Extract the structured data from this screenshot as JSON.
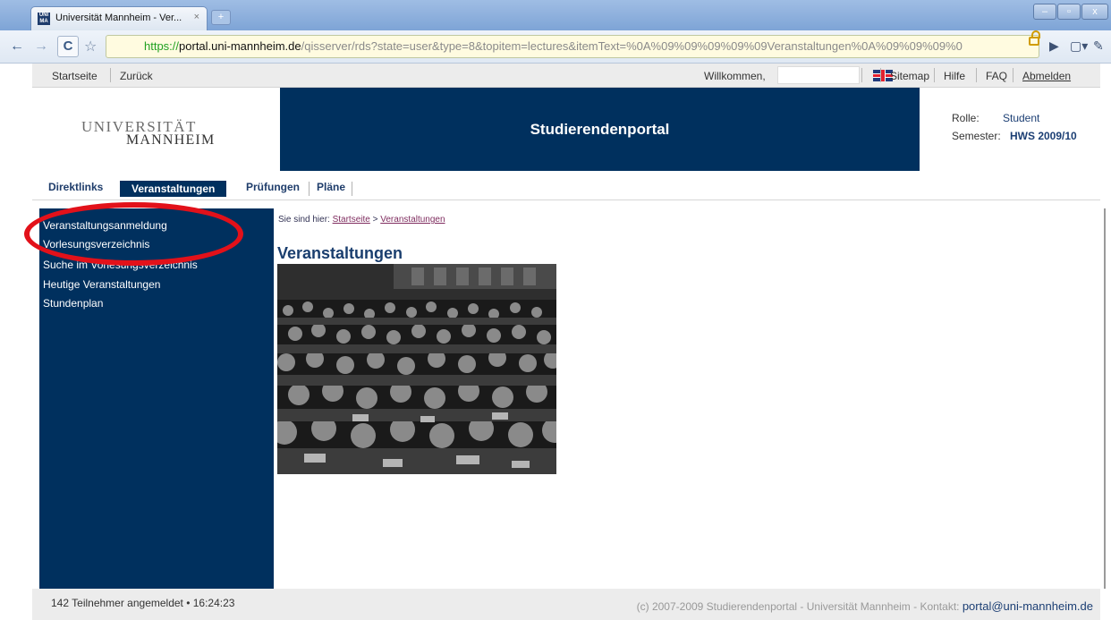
{
  "browser": {
    "tab_title": "Universität Mannheim - Ver...",
    "tab_close": "×",
    "new_tab": "+",
    "favicon_text": "UNI MA",
    "url_scheme": "https://",
    "url_host": "portal.uni-mannheim.de",
    "url_rest": "/qisserver/rds?state=user&type=8&topitem=lectures&itemText=%0A%09%09%09%09%09Veranstaltungen%0A%09%09%09%0"
  },
  "utility": {
    "startseite": "Startseite",
    "zurueck": "Zurück",
    "welcome": "Willkommen,",
    "sitemap": "Sitemap",
    "hilfe": "Hilfe",
    "faq": "FAQ",
    "abmelden": "Abmelden"
  },
  "header": {
    "logo_line1": "UNIVERSITÄT",
    "logo_line2": "MANNHEIM",
    "banner": "Studierendenportal",
    "role_label": "Rolle:",
    "role_value": "Student",
    "semester_label": "Semester:",
    "semester_value": "HWS 2009/10"
  },
  "main_nav": [
    "Direktlinks",
    "Veranstaltungen",
    "Prüfungen",
    "Pläne"
  ],
  "sidebar": [
    "Veranstaltungsanmeldung",
    "Vorlesungsverzeichnis",
    "Suche im Vorlesungsverzeichnis",
    "Heutige Veranstaltungen",
    "Stundenplan"
  ],
  "content": {
    "breadcrumb_prefix": "Sie sind hier:",
    "breadcrumb_home": "Startseite",
    "breadcrumb_sep": ">",
    "breadcrumb_current": "Veranstaltungen",
    "title": "Veranstaltungen"
  },
  "footer": {
    "status": "142 Teilnehmer angemeldet • 16:24:23",
    "copyright": "(c) 2007-2009 Studierendenportal - Universität Mannheim - Kontakt:",
    "contact": "portal@uni-mannheim.de"
  },
  "colors": {
    "brand_blue": "#00305e",
    "annotation_red": "#e2111a"
  }
}
